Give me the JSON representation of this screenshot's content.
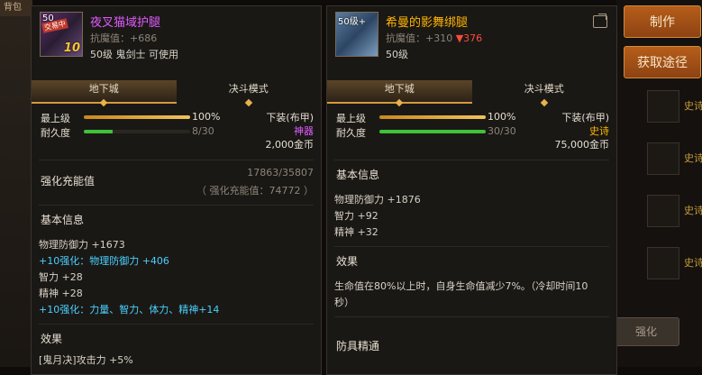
{
  "left_edge": {
    "strips": [
      "背包",
      "",
      "",
      "",
      ""
    ]
  },
  "panel1": {
    "level_tag": "50",
    "seal_text": "交易中",
    "enhance_badge": "10",
    "name": "夜叉猫域护腿",
    "resist_label": "抗魔值：",
    "resist_value": "+686",
    "requirement": "50级 鬼剑士 可使用",
    "tabs": [
      "地下城",
      "决斗模式"
    ],
    "top_level_label": "最上级",
    "top_level_value": "100%",
    "top_level_fraction": 1.0,
    "durability_label": "耐久度",
    "durability_value": "8/30",
    "durability_fraction": 0.27,
    "slot": "下装(布甲)",
    "rarity": "神器",
    "rarity_color": "#e05bff",
    "price": "2,000金币",
    "charge_label": "强化充能值",
    "charge_value": "17863/35807",
    "charge_sub": "（ 强化充能值：74772 ）",
    "basic_title": "基本信息",
    "lines": [
      {
        "text": "物理防御力 +1673",
        "style": "normal"
      },
      {
        "text": "+10强化：物理防御力 +406",
        "style": "cyan"
      },
      {
        "text": "智力 +28",
        "style": "normal"
      },
      {
        "text": "精神 +28",
        "style": "normal"
      },
      {
        "text": "+10强化：力量、智力、体力、精神+14",
        "style": "cyan"
      }
    ],
    "effect_title": "效果",
    "effect_line": "[鬼月决]攻击力 +5%"
  },
  "panel2": {
    "level_tag": "50级+",
    "name": "希曼的影舞绑腿",
    "resist_label": "抗魔值：",
    "resist_value": "+310",
    "resist_diff": "▼376",
    "requirement": "50级",
    "tabs": [
      "地下城",
      "决斗模式"
    ],
    "top_level_label": "最上级",
    "top_level_value": "100%",
    "top_level_fraction": 1.0,
    "durability_label": "耐久度",
    "durability_value": "30/30",
    "durability_fraction": 1.0,
    "slot": "下装(布甲)",
    "rarity": "史诗",
    "rarity_color": "#ffb400",
    "price": "75,000金币",
    "basic_title": "基本信息",
    "lines": [
      {
        "text": "物理防御力 +1876"
      },
      {
        "text": "智力 +92"
      },
      {
        "text": "精神 +32"
      }
    ],
    "effect_title": "效果",
    "effect_line1": "生命值在80%以上时，自身生命值减少7%。（冷却时间10",
    "effect_line2": "秒）",
    "mastery_title": "防具精通"
  },
  "right_side": {
    "craft_button": "制作",
    "obtain_button": "获取途径",
    "epic_badge": "史诗",
    "strengthen_button": "强化"
  },
  "colors": {
    "accent": "#d49b3b",
    "cyan": "#4ad0ff",
    "danger": "#ff4a3d"
  }
}
